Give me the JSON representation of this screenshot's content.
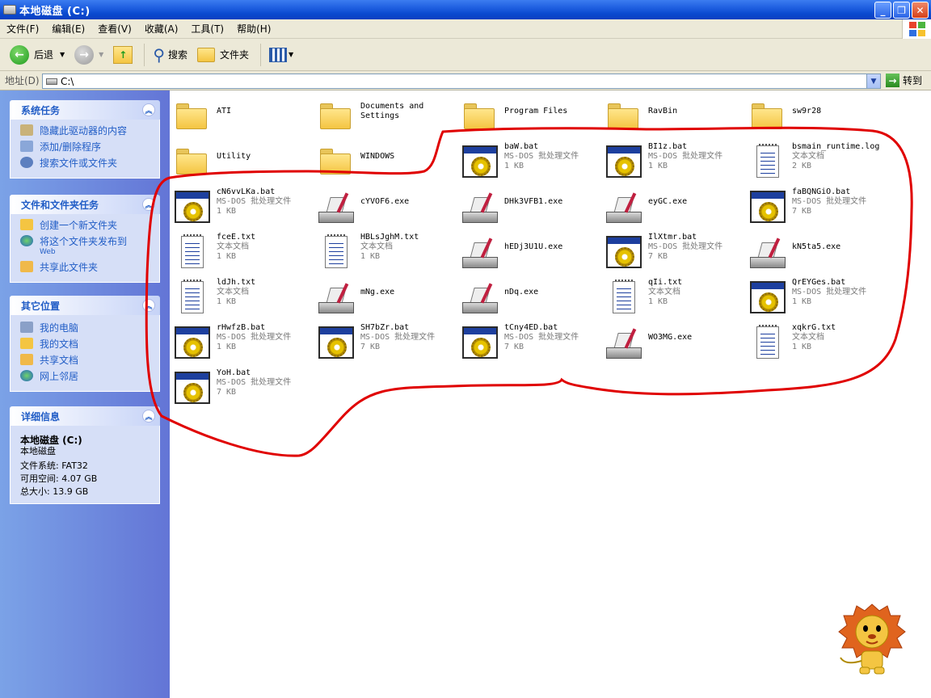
{
  "window": {
    "title": "本地磁盘 (C:)"
  },
  "menu": [
    "文件(F)",
    "编辑(E)",
    "查看(V)",
    "收藏(A)",
    "工具(T)",
    "帮助(H)"
  ],
  "toolbar": {
    "back": "后退",
    "search": "搜索",
    "folders": "文件夹"
  },
  "address": {
    "label": "地址(D)",
    "value": "C:\\",
    "go": "转到"
  },
  "sidebar": {
    "system_tasks": {
      "title": "系统任务",
      "items": [
        "隐藏此驱动器的内容",
        "添加/删除程序",
        "搜索文件或文件夹"
      ]
    },
    "file_tasks": {
      "title": "文件和文件夹任务",
      "items": [
        "创建一个新文件夹",
        "将这个文件夹发布到",
        "Web",
        "共享此文件夹"
      ]
    },
    "other_places": {
      "title": "其它位置",
      "items": [
        "我的电脑",
        "我的文档",
        "共享文档",
        "网上邻居"
      ]
    },
    "details": {
      "title": "详细信息",
      "name": "本地磁盘 (C:)",
      "type": "本地磁盘",
      "fs": "文件系统: FAT32",
      "free": "可用空间: 4.07 GB",
      "total": "总大小: 13.9 GB"
    }
  },
  "files": [
    {
      "name": "ATI",
      "kind": "folder"
    },
    {
      "name": "Documents and",
      "name2": "Settings",
      "kind": "folder"
    },
    {
      "name": "Program Files",
      "kind": "folder"
    },
    {
      "name": "RavBin",
      "kind": "folder"
    },
    {
      "name": "sw9r28",
      "kind": "folder"
    },
    {
      "name": "Utility",
      "kind": "folder"
    },
    {
      "name": "WINDOWS",
      "kind": "folder"
    },
    {
      "name": "baW.bat",
      "type": "MS-DOS 批处理文件",
      "size": "1 KB",
      "kind": "bat"
    },
    {
      "name": "BI1z.bat",
      "type": "MS-DOS 批处理文件",
      "size": "1 KB",
      "kind": "bat"
    },
    {
      "name": "bsmain_runtime.log",
      "type": "文本文档",
      "size": "2 KB",
      "kind": "txt"
    },
    {
      "name": "cN6vvLKa.bat",
      "type": "MS-DOS 批处理文件",
      "size": "1 KB",
      "kind": "bat"
    },
    {
      "name": "cYVOF6.exe",
      "kind": "exe"
    },
    {
      "name": "DHk3VFB1.exe",
      "kind": "exe"
    },
    {
      "name": "eyGC.exe",
      "kind": "exe"
    },
    {
      "name": "faBQNGiO.bat",
      "type": "MS-DOS 批处理文件",
      "size": "7 KB",
      "kind": "bat"
    },
    {
      "name": "fceE.txt",
      "type": "文本文档",
      "size": "1 KB",
      "kind": "txt"
    },
    {
      "name": "HBLsJghM.txt",
      "type": "文本文档",
      "size": "1 KB",
      "kind": "txt"
    },
    {
      "name": "hEDj3U1U.exe",
      "kind": "exe"
    },
    {
      "name": "IlXtmr.bat",
      "type": "MS-DOS 批处理文件",
      "size": "7 KB",
      "kind": "bat"
    },
    {
      "name": "kN5ta5.exe",
      "kind": "exe"
    },
    {
      "name": "ldJh.txt",
      "type": "文本文档",
      "size": "1 KB",
      "kind": "txt"
    },
    {
      "name": "mNg.exe",
      "kind": "exe"
    },
    {
      "name": "nDq.exe",
      "kind": "exe"
    },
    {
      "name": "qIi.txt",
      "type": "文本文档",
      "size": "1 KB",
      "kind": "txt"
    },
    {
      "name": "QrEYGes.bat",
      "type": "MS-DOS 批处理文件",
      "size": "1 KB",
      "kind": "bat"
    },
    {
      "name": "rHwfzB.bat",
      "type": "MS-DOS 批处理文件",
      "size": "1 KB",
      "kind": "bat"
    },
    {
      "name": "SH7bZr.bat",
      "type": "MS-DOS 批处理文件",
      "size": "7 KB",
      "kind": "bat"
    },
    {
      "name": "tCny4ED.bat",
      "type": "MS-DOS 批处理文件",
      "size": "7 KB",
      "kind": "bat"
    },
    {
      "name": "WO3MG.exe",
      "kind": "exe"
    },
    {
      "name": "xqkrG.txt",
      "type": "文本文档",
      "size": "1 KB",
      "kind": "txt"
    },
    {
      "name": "YoH.bat",
      "type": "MS-DOS 批处理文件",
      "size": "7 KB",
      "kind": "bat"
    }
  ],
  "colors": {
    "titlebar": "#0a4ad0",
    "sidebar": "#6375d6",
    "link": "#215dc6",
    "annotation": "#e00000"
  }
}
